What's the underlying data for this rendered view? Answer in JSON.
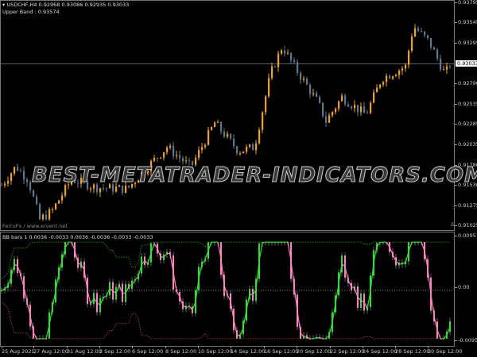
{
  "chart_header": {
    "symbol_line": "USDCHF,H4  0.92968 0.93086 0.92935 0.93033",
    "upper_band": "Upper Band : 0.93574",
    "credit": "FerruFx / www.ervent.net"
  },
  "indicator_header": "BB bars 1 0.0036 -0.0033 0.0036 -0.0036 -0.0033 -0.0033",
  "watermark": "BEST-METATRADER-INDICATORS.COM",
  "price_axis": [
    "0.93795",
    "0.93545",
    "0.93295",
    "0.92790",
    "0.92535",
    "0.92285",
    "0.92035",
    "0.91780",
    "0.91530",
    "0.91275",
    "0.91025"
  ],
  "current_price": "0.93033",
  "indicator_axis": [
    "0.0095",
    "0.00",
    "-0.0095"
  ],
  "time_axis": [
    "25 Aug 2021",
    "27 Aug 12:00",
    "31 Aug 12:00",
    "2 Sep 12:00",
    "6 Sep 12:00",
    "8 Sep 12:00",
    "10 Sep 12:00",
    "14 Sep 12:00",
    "16 Sep 12:00",
    "20 Sep 12:00",
    "22 Sep 12:00",
    "24 Sep 12:00",
    "28 Sep 12:00",
    "30 Sep 12:00"
  ],
  "colors": {
    "bull": "#f0a020",
    "bear": "#5a7890",
    "osc_up": "#30e030",
    "osc_down": "#ff80c0",
    "band_upper": "#30a030",
    "band_lower": "#c04080",
    "grid_line": "#8899aa"
  },
  "price_path": [
    [
      0,
      0.915
    ],
    [
      20,
      0.9176
    ],
    [
      35,
      0.916
    ],
    [
      50,
      0.911
    ],
    [
      65,
      0.912
    ],
    [
      90,
      0.916
    ],
    [
      120,
      0.915
    ],
    [
      160,
      0.9148
    ],
    [
      185,
      0.9175
    ],
    [
      210,
      0.92
    ],
    [
      240,
      0.9175
    ],
    [
      270,
      0.923
    ],
    [
      300,
      0.9195
    ],
    [
      320,
      0.92
    ],
    [
      340,
      0.929
    ],
    [
      355,
      0.9325
    ],
    [
      370,
      0.93
    ],
    [
      400,
      0.9255
    ],
    [
      410,
      0.9232
    ],
    [
      430,
      0.9262
    ],
    [
      460,
      0.924
    ],
    [
      480,
      0.9285
    ],
    [
      510,
      0.93
    ],
    [
      520,
      0.935
    ],
    [
      540,
      0.933
    ],
    [
      560,
      0.929
    ],
    [
      566,
      0.9303
    ]
  ]
}
